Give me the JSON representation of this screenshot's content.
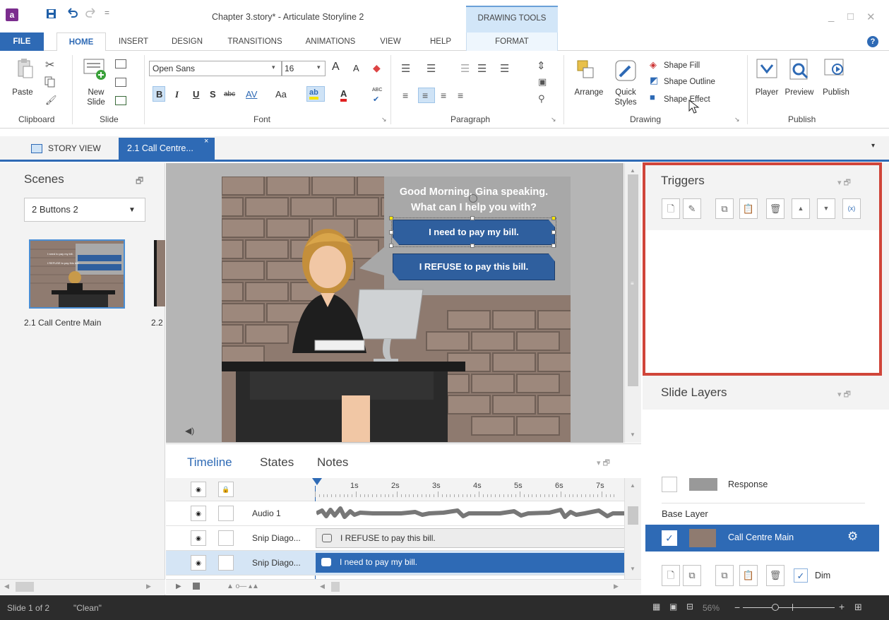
{
  "app": {
    "title": "Chapter 3.story* - Articulate Storyline 2",
    "logo": "a",
    "contextual_group": "DRAWING TOOLS",
    "window_controls": {
      "minimize": "_",
      "maximize": "□",
      "close": "✕"
    },
    "help": "?"
  },
  "quick_access": {
    "save": "save-icon",
    "undo": "undo-icon",
    "redo": "redo-icon",
    "customize": "customize-icon"
  },
  "ribbon_tabs": [
    "FILE",
    "HOME",
    "INSERT",
    "DESIGN",
    "TRANSITIONS",
    "ANIMATIONS",
    "VIEW",
    "HELP",
    "FORMAT"
  ],
  "ribbon": {
    "clipboard": {
      "paste": "Paste",
      "group": "Clipboard"
    },
    "slide": {
      "new_slide_line1": "New",
      "new_slide_line2": "Slide",
      "group": "Slide"
    },
    "font": {
      "family": "Open Sans",
      "size": "16",
      "group": "Font",
      "bold": "B",
      "italic": "I",
      "underline": "U",
      "shadow": "S",
      "strike": "abc",
      "spacing": "AV",
      "case": "Aa",
      "highlight": "ab",
      "color": "A",
      "grow": "A",
      "shrink": "A",
      "spelling": "ABC"
    },
    "paragraph": {
      "group": "Paragraph"
    },
    "drawing": {
      "arrange": "Arrange",
      "quick_styles_line1": "Quick",
      "quick_styles_line2": "Styles",
      "shape_fill": "Shape Fill",
      "shape_outline": "Shape Outline",
      "shape_effect": "Shape Effect",
      "group": "Drawing"
    },
    "publish": {
      "player": "Player",
      "preview": "Preview",
      "publish": "Publish",
      "group": "Publish"
    }
  },
  "doc_tabs": {
    "story_view": "STORY VIEW",
    "active": "2.1 Call Centre...",
    "close": "×"
  },
  "scenes": {
    "title": "Scenes",
    "selected": "2 Buttons 2",
    "thumbnails": [
      {
        "label": "2.1 Call Centre Main"
      },
      {
        "label": "2.2"
      }
    ]
  },
  "slide": {
    "speech_line1": "Good Morning, Gina speaking.",
    "speech_line2": "What can I help you with?",
    "button1": "I need to pay my bill.",
    "button2": "I REFUSE to pay this bill.",
    "thumb_button1": "I need to pay my bill.",
    "thumb_button2": "I REFUSE to pay this bill."
  },
  "timeline": {
    "tabs": [
      "Timeline",
      "States",
      "Notes"
    ],
    "ruler": [
      "1s",
      "2s",
      "3s",
      "4s",
      "5s",
      "6s",
      "7s"
    ],
    "rows": [
      {
        "name": "Audio 1",
        "bar": ""
      },
      {
        "name": "Snip Diago...",
        "bar": "I REFUSE to pay this bill."
      },
      {
        "name": "Snip Diago...",
        "bar": "I need to pay my bill."
      }
    ]
  },
  "triggers": {
    "title": "Triggers"
  },
  "layers": {
    "title": "Slide Layers",
    "response": "Response",
    "base_label": "Base Layer",
    "base_name": "Call Centre Main",
    "dim": "Dim"
  },
  "status": {
    "slide": "Slide 1 of 2",
    "theme": "\"Clean\"",
    "zoom": "56%",
    "minus": "−",
    "plus": "+"
  },
  "colors": {
    "accent": "#2e6ab5",
    "highlight_box": "#d0453a",
    "button_fill": "#2f5f9e"
  }
}
